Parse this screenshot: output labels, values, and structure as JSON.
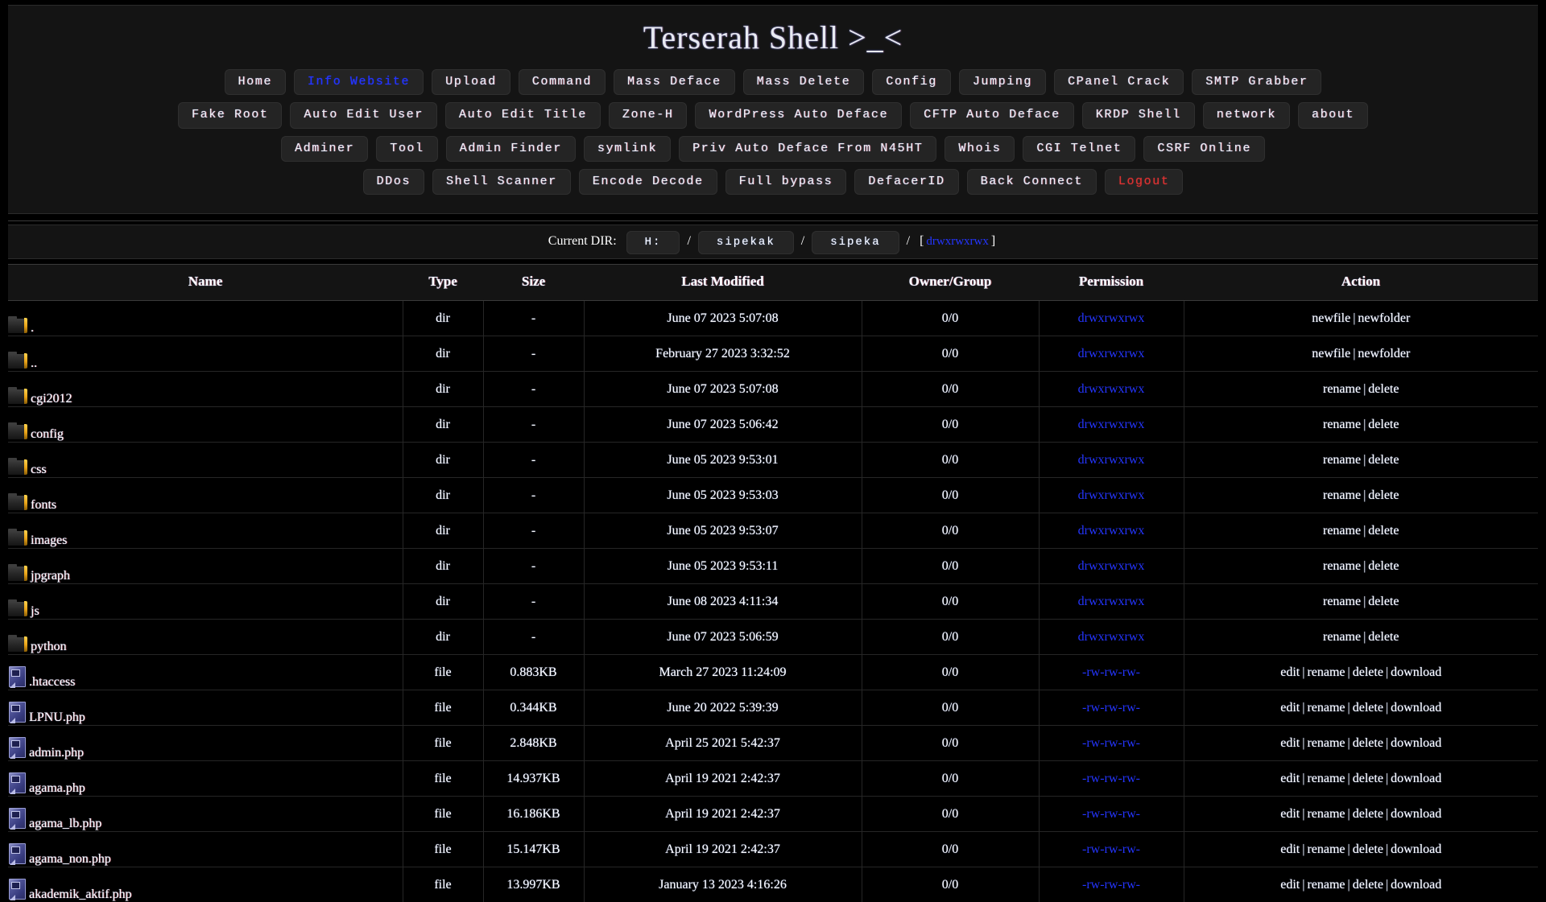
{
  "header": {
    "title": "Terserah Shell >_<"
  },
  "nav": {
    "rows": [
      [
        {
          "label": "Home",
          "style": "normal"
        },
        {
          "label": "Info Website",
          "style": "blue"
        },
        {
          "label": "Upload",
          "style": "normal"
        },
        {
          "label": "Command",
          "style": "normal"
        },
        {
          "label": "Mass Deface",
          "style": "normal"
        },
        {
          "label": "Mass Delete",
          "style": "normal"
        },
        {
          "label": "Config",
          "style": "normal"
        },
        {
          "label": "Jumping",
          "style": "normal"
        },
        {
          "label": "CPanel Crack",
          "style": "normal"
        },
        {
          "label": "SMTP Grabber",
          "style": "normal"
        }
      ],
      [
        {
          "label": "Fake Root",
          "style": "normal"
        },
        {
          "label": "Auto Edit User",
          "style": "normal"
        },
        {
          "label": "Auto Edit Title",
          "style": "normal"
        },
        {
          "label": "Zone-H",
          "style": "normal"
        },
        {
          "label": "WordPress Auto Deface",
          "style": "normal"
        },
        {
          "label": "CFTP Auto Deface",
          "style": "normal"
        },
        {
          "label": "KRDP Shell",
          "style": "normal"
        },
        {
          "label": "network",
          "style": "normal"
        },
        {
          "label": "about",
          "style": "normal"
        }
      ],
      [
        {
          "label": "Adminer",
          "style": "normal"
        },
        {
          "label": "Tool",
          "style": "normal"
        },
        {
          "label": "Admin Finder",
          "style": "normal"
        },
        {
          "label": "symlink",
          "style": "normal"
        },
        {
          "label": "Priv Auto Deface From N45HT",
          "style": "normal"
        },
        {
          "label": "Whois",
          "style": "normal"
        },
        {
          "label": "CGI Telnet",
          "style": "normal"
        },
        {
          "label": "CSRF Online",
          "style": "normal"
        }
      ],
      [
        {
          "label": "DDos",
          "style": "normal"
        },
        {
          "label": "Shell Scanner",
          "style": "normal"
        },
        {
          "label": "Encode Decode",
          "style": "normal"
        },
        {
          "label": "Full bypass",
          "style": "normal"
        },
        {
          "label": "DefacerID",
          "style": "normal"
        },
        {
          "label": "Back Connect",
          "style": "normal"
        },
        {
          "label": "Logout",
          "style": "red"
        }
      ]
    ]
  },
  "current_dir": {
    "label": "Current DIR:",
    "segments": [
      "H:",
      "sipekak",
      "sipeka"
    ],
    "separator": "/",
    "permission": "drwxrwxrwx",
    "bracket_open": "[",
    "bracket_close": "]"
  },
  "table": {
    "columns": [
      "Name",
      "Type",
      "Size",
      "Last Modified",
      "Owner/Group",
      "Permission",
      "Action"
    ],
    "rows": [
      {
        "icon": "folder-icon",
        "name": ".",
        "type": "dir",
        "size": "-",
        "modified": "June 07 2023 5:07:08",
        "owner": "0/0",
        "permission": "drwxrwxrwx",
        "actions": [
          "newfile",
          "newfolder"
        ]
      },
      {
        "icon": "folder-icon",
        "name": "..",
        "type": "dir",
        "size": "-",
        "modified": "February 27 2023 3:32:52",
        "owner": "0/0",
        "permission": "drwxrwxrwx",
        "actions": [
          "newfile",
          "newfolder"
        ]
      },
      {
        "icon": "folder-icon",
        "name": "cgi2012",
        "type": "dir",
        "size": "-",
        "modified": "June 07 2023 5:07:08",
        "owner": "0/0",
        "permission": "drwxrwxrwx",
        "actions": [
          "rename",
          "delete"
        ]
      },
      {
        "icon": "folder-icon",
        "name": "config",
        "type": "dir",
        "size": "-",
        "modified": "June 07 2023 5:06:42",
        "owner": "0/0",
        "permission": "drwxrwxrwx",
        "actions": [
          "rename",
          "delete"
        ]
      },
      {
        "icon": "folder-icon",
        "name": "css",
        "type": "dir",
        "size": "-",
        "modified": "June 05 2023 9:53:01",
        "owner": "0/0",
        "permission": "drwxrwxrwx",
        "actions": [
          "rename",
          "delete"
        ]
      },
      {
        "icon": "folder-icon",
        "name": "fonts",
        "type": "dir",
        "size": "-",
        "modified": "June 05 2023 9:53:03",
        "owner": "0/0",
        "permission": "drwxrwxrwx",
        "actions": [
          "rename",
          "delete"
        ]
      },
      {
        "icon": "folder-icon",
        "name": "images",
        "type": "dir",
        "size": "-",
        "modified": "June 05 2023 9:53:07",
        "owner": "0/0",
        "permission": "drwxrwxrwx",
        "actions": [
          "rename",
          "delete"
        ]
      },
      {
        "icon": "folder-icon",
        "name": "jpgraph",
        "type": "dir",
        "size": "-",
        "modified": "June 05 2023 9:53:11",
        "owner": "0/0",
        "permission": "drwxrwxrwx",
        "actions": [
          "rename",
          "delete"
        ]
      },
      {
        "icon": "folder-icon",
        "name": "js",
        "type": "dir",
        "size": "-",
        "modified": "June 08 2023 4:11:34",
        "owner": "0/0",
        "permission": "drwxrwxrwx",
        "actions": [
          "rename",
          "delete"
        ]
      },
      {
        "icon": "folder-icon",
        "name": "python",
        "type": "dir",
        "size": "-",
        "modified": "June 07 2023 5:06:59",
        "owner": "0/0",
        "permission": "drwxrwxrwx",
        "actions": [
          "rename",
          "delete"
        ]
      },
      {
        "icon": "file-icon",
        "name": ".htaccess",
        "type": "file",
        "size": "0.883KB",
        "modified": "March 27 2023 11:24:09",
        "owner": "0/0",
        "permission": "-rw-rw-rw-",
        "actions": [
          "edit",
          "rename",
          "delete",
          "download"
        ]
      },
      {
        "icon": "file-icon",
        "name": "LPNU.php",
        "type": "file",
        "size": "0.344KB",
        "modified": "June 20 2022 5:39:39",
        "owner": "0/0",
        "permission": "-rw-rw-rw-",
        "actions": [
          "edit",
          "rename",
          "delete",
          "download"
        ]
      },
      {
        "icon": "file-icon",
        "name": "admin.php",
        "type": "file",
        "size": "2.848KB",
        "modified": "April 25 2021 5:42:37",
        "owner": "0/0",
        "permission": "-rw-rw-rw-",
        "actions": [
          "edit",
          "rename",
          "delete",
          "download"
        ]
      },
      {
        "icon": "file-icon",
        "name": "agama.php",
        "type": "file",
        "size": "14.937KB",
        "modified": "April 19 2021 2:42:37",
        "owner": "0/0",
        "permission": "-rw-rw-rw-",
        "actions": [
          "edit",
          "rename",
          "delete",
          "download"
        ]
      },
      {
        "icon": "file-icon",
        "name": "agama_lb.php",
        "type": "file",
        "size": "16.186KB",
        "modified": "April 19 2021 2:42:37",
        "owner": "0/0",
        "permission": "-rw-rw-rw-",
        "actions": [
          "edit",
          "rename",
          "delete",
          "download"
        ]
      },
      {
        "icon": "file-icon",
        "name": "agama_non.php",
        "type": "file",
        "size": "15.147KB",
        "modified": "April 19 2021 2:42:37",
        "owner": "0/0",
        "permission": "-rw-rw-rw-",
        "actions": [
          "edit",
          "rename",
          "delete",
          "download"
        ]
      },
      {
        "icon": "file-icon",
        "name": "akademik_aktif.php",
        "type": "file",
        "size": "13.997KB",
        "modified": "January 13 2023 4:16:26",
        "owner": "0/0",
        "permission": "-rw-rw-rw-",
        "actions": [
          "edit",
          "rename",
          "delete",
          "download"
        ]
      }
    ]
  },
  "colors": {
    "background": "#000000",
    "panel": "#141414",
    "button": "#242424",
    "accent_blue": "#2435ff",
    "accent_red": "#d93232",
    "text": "#ffffff",
    "folder_accent": "#e8a317",
    "file_icon": "#4e5296"
  }
}
